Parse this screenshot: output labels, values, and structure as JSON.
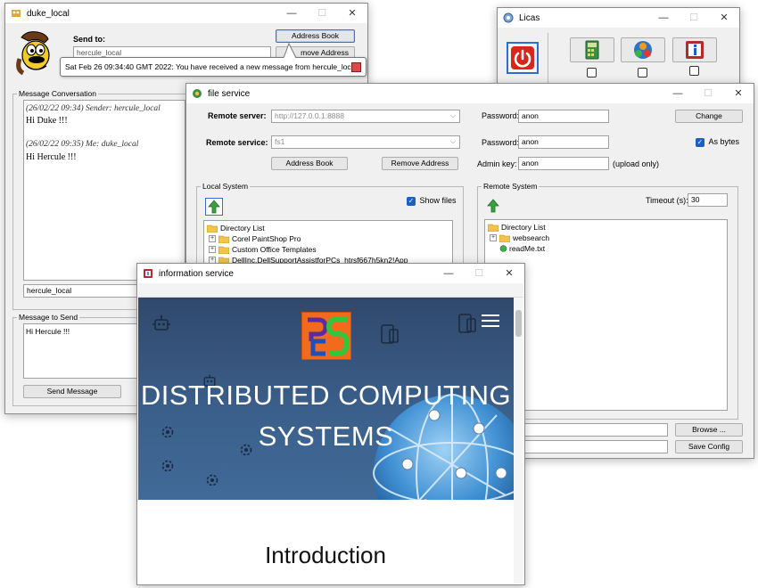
{
  "chat": {
    "title": "duke_local",
    "send_to_label": "Send to:",
    "recipient_value": "hercule_local",
    "address_book": "Address Book",
    "remove_address_partial": "move Address",
    "notification": "Sat Feb 26 09:34:40 GMT 2022: You have received a new message from hercule_local",
    "conversation_title": "Message Conversation",
    "messages": [
      {
        "meta": "(26/02/22 09:34) Sender: hercule_local",
        "text": "Hi Duke !!!"
      },
      {
        "meta": "(26/02/22 09:35) Me: duke_local",
        "text": "Hi Hercule !!!"
      }
    ],
    "user_field": "hercule_local",
    "send_title": "Message to Send",
    "send_text": "Hi Hercule !!!",
    "send_button": "Send Message"
  },
  "licas": {
    "title": "Licas"
  },
  "file": {
    "title": "file service",
    "remote_server_label": "Remote server:",
    "remote_server_value": "http://127.0.0.1:8888",
    "password_label": "Password:",
    "password_value": "anon",
    "change": "Change",
    "remote_service_label": "Remote service:",
    "remote_service_value": "fs1",
    "password2_value": "anon",
    "as_bytes": "As bytes",
    "address_book": "Address Book",
    "remove_address": "Remove Address",
    "admin_key_label": "Admin key:",
    "admin_key_value": "anon",
    "upload_only": "(upload only)",
    "local_title": "Local System",
    "show_files": "Show files",
    "local_tree": {
      "root": "Directory List",
      "items": [
        "Corel PaintShop Pro",
        "Custom Office Templates",
        "DellInc.DellSupportAssistforPCs_htrsf667h5kn2!App"
      ]
    },
    "remote_title": "Remote System",
    "timeout_label": "Timeout (s):",
    "timeout_value": "30",
    "remote_tree": {
      "root": "Directory List",
      "folder": "websearch",
      "file": "readMe.txt"
    },
    "browse": "Browse ...",
    "save_config": "Save Config"
  },
  "info": {
    "title": "information service",
    "hero_line1": "DISTRIBUTED COMPUTING",
    "hero_line2": "SYSTEMS",
    "section_heading": "Introduction"
  },
  "colors": {
    "hero_top": "#31486c",
    "hero_bottom": "#426a98",
    "logo_orange": "#f26a1b",
    "logo_green": "#37c43c",
    "logo_purple": "#5a2ca0",
    "power_red": "#d9261c",
    "checkbox_blue": "#1a5fc2"
  }
}
